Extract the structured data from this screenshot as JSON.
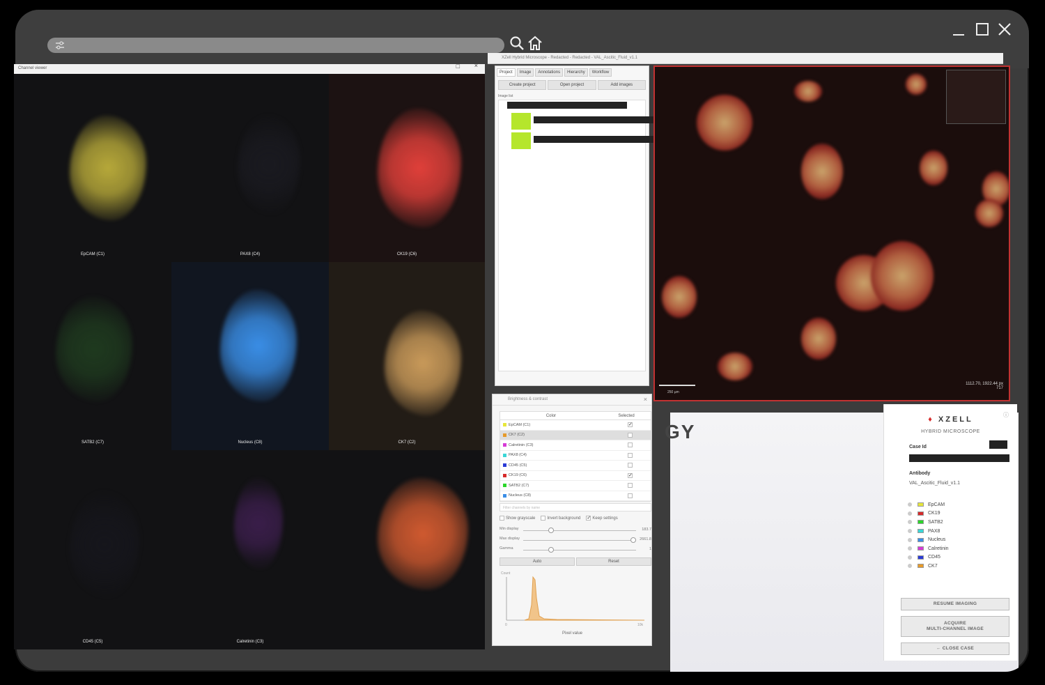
{
  "viewer": {
    "caption": "Channel viewer",
    "close": "×",
    "restore": "□",
    "tiles": [
      {
        "label": "EpCAM (C1)",
        "color": "#b7a93a"
      },
      {
        "label": "PAX8 (C4)",
        "color": "#1a1a20"
      },
      {
        "label": "CK19 (C6)",
        "color": "#e0403a"
      },
      {
        "label": "SATB2 (C7)",
        "color": "#1f3a1f"
      },
      {
        "label": "Nucleus (C8)",
        "color": "#3a8ee6"
      },
      {
        "label": "CK7 (C2)",
        "color": "#c99a5a"
      },
      {
        "label": "CD45 (C5)",
        "color": "#16161c"
      },
      {
        "label": "Calretinin (C3)",
        "color": "#3a1e4a"
      },
      {
        "label": "",
        "color": "#d05a30"
      }
    ]
  },
  "app": {
    "title": "XZell Hybrid Microscope - Redacted - Redacted - VAL_Ascitic_Fluid_v1.1",
    "tabs": [
      "Project",
      "Image",
      "Annotations",
      "Hierarchy",
      "Workflow"
    ],
    "buttons": [
      "Create project",
      "Open project",
      "Add images"
    ],
    "image_list_label": "Image list",
    "scale_label": "250 µm",
    "coords_line1": "1112.70, 1922.44 px",
    "coords_line2": "717"
  },
  "bc": {
    "title": "Brightness & contrast",
    "col_color": "Color",
    "col_selected": "Selected",
    "channels": [
      {
        "name": "EpCAM (C1)",
        "color": "#e6e63a",
        "checked": "✓"
      },
      {
        "name": "CK7 (C2)",
        "color": "#e69a2a",
        "checked": ""
      },
      {
        "name": "Calretinin (C3)",
        "color": "#d63ad6",
        "checked": ""
      },
      {
        "name": "PAX8 (C4)",
        "color": "#3ad6d6",
        "checked": ""
      },
      {
        "name": "CD45 (C5)",
        "color": "#2a3ad6",
        "checked": ""
      },
      {
        "name": "CK19 (C6)",
        "color": "#d62a2a",
        "checked": "✓"
      },
      {
        "name": "SATB2 (C7)",
        "color": "#2ad62a",
        "checked": ""
      },
      {
        "name": "Nucleus (C8)",
        "color": "#3a8ee6",
        "checked": ""
      }
    ],
    "filter_placeholder": "Filter channels by name",
    "opt_grayscale": "Show grayscale",
    "opt_invert": "Invert background",
    "opt_keep": "Keep settings",
    "min_label": "Min display",
    "min_val": "183.7",
    "max_label": "Max display",
    "max_val": "2661.8",
    "gamma_label": "Gamma",
    "gamma_val": "1",
    "btn_auto": "Auto",
    "btn_reset": "Reset",
    "hist_ylabel": "Count",
    "hist_xlabel": "Pixel value",
    "hist_xmin": "0",
    "hist_xmax": "10k"
  },
  "xzell": {
    "brand": "XZELL",
    "subtitle": "HYBRID MICROSCOPE",
    "case_label": "Case Id",
    "antibody_label": "Antibody",
    "antibody_value": "VAL_Ascitic_Fluid_v1.1",
    "legend": [
      {
        "name": "EpCAM",
        "color": "#e6e63a"
      },
      {
        "name": "CK19",
        "color": "#d62a2a"
      },
      {
        "name": "SATB2",
        "color": "#2ad62a"
      },
      {
        "name": "PAX8",
        "color": "#3ad6d6"
      },
      {
        "name": "Nucleus",
        "color": "#3a8ee6"
      },
      {
        "name": "Calretinin",
        "color": "#d63ad6"
      },
      {
        "name": "CD45",
        "color": "#2a3ad6"
      },
      {
        "name": "CK7",
        "color": "#e69a2a"
      }
    ],
    "btn_resume": "RESUME IMAGING",
    "btn_acquire_1": "ACQUIRE",
    "btn_acquire_2": "MULTI-CHANNEL IMAGE",
    "btn_close": "← CLOSE CASE",
    "info_icon": "ⓘ"
  },
  "bg_text": "GY"
}
